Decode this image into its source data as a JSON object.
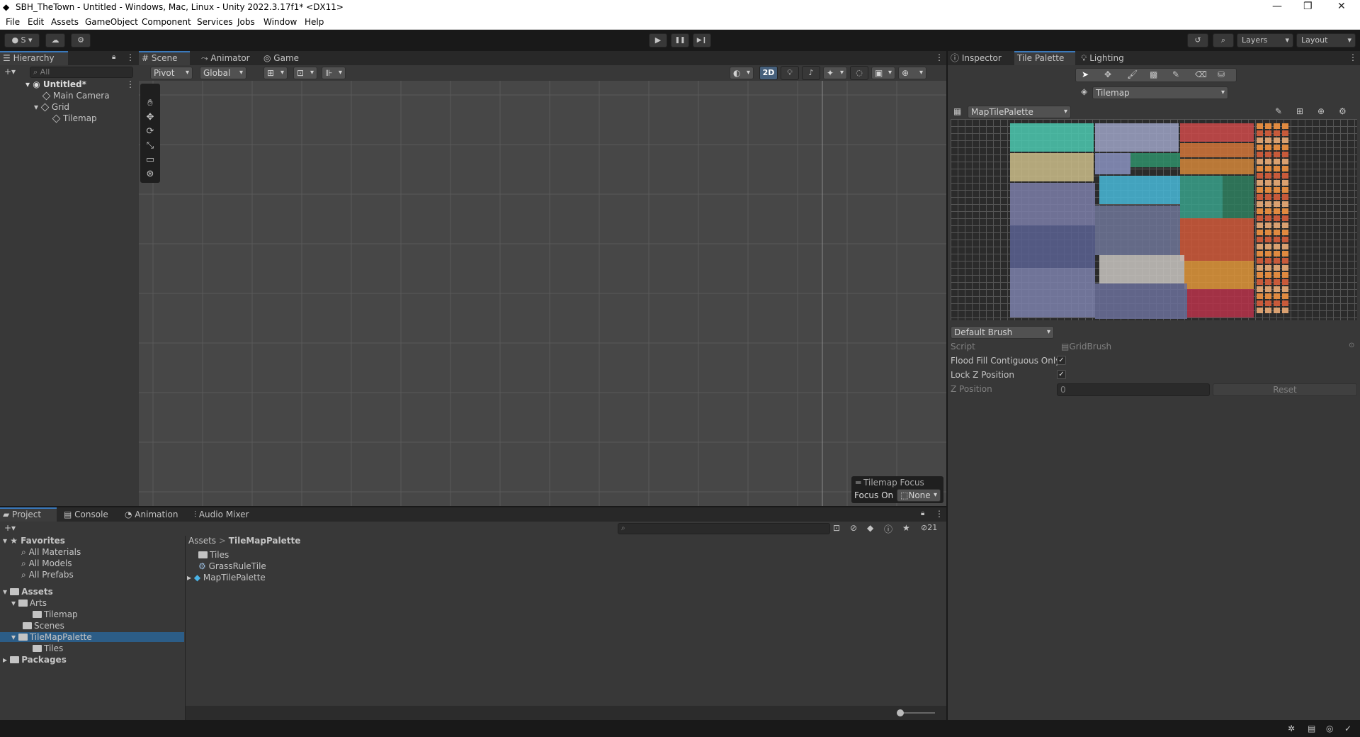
{
  "window": {
    "title": "SBH_TheTown - Untitled - Windows, Mac, Linux - Unity 2022.3.17f1* <DX11>",
    "minimize": "—",
    "restore": "❐",
    "close": "✕"
  },
  "menu": [
    "File",
    "Edit",
    "Assets",
    "GameObject",
    "Component",
    "Services",
    "Jobs",
    "Window",
    "Help"
  ],
  "toolbar": {
    "account": "S",
    "play": "▶",
    "pause": "❚❚",
    "step": "▶❙",
    "layers": "Layers",
    "layout": "Layout"
  },
  "hierarchy": {
    "tab": "Hierarchy",
    "search_placeholder": "All",
    "add": "+▾",
    "items": [
      "Untitled*",
      "Main Camera",
      "Grid",
      "Tilemap"
    ]
  },
  "scene_tabs": [
    "Scene",
    "Animator",
    "Game"
  ],
  "scene_toolbar": {
    "pivot": "Pivot",
    "global": "Global",
    "mode2d": "2D"
  },
  "tilemap_focus": {
    "title": "Tilemap Focus",
    "label": "Focus On",
    "value": "None"
  },
  "right_tabs": [
    "Inspector",
    "Tile Palette",
    "Lighting"
  ],
  "tile_palette": {
    "active_target": "Tilemap",
    "palette": "MapTilePalette",
    "brush": "Default Brush",
    "script_label": "Script",
    "script_value": "GridBrush",
    "flood_fill_label": "Flood Fill Contiguous Only",
    "flood_fill_checked": "✓",
    "lock_z_label": "Lock Z Position",
    "lock_z_checked": "✓",
    "z_position_label": "Z Position",
    "z_position_value": "0",
    "reset": "Reset"
  },
  "bottom_tabs": [
    "Project",
    "Console",
    "Animation",
    "Audio Mixer"
  ],
  "project": {
    "add": "+▾",
    "hidden_count": "21",
    "tree": {
      "favorites": "Favorites",
      "fav_items": [
        "All Materials",
        "All Models",
        "All Prefabs"
      ],
      "assets": "Assets",
      "arts": "Arts",
      "arts_tilemap": "Tilemap",
      "scenes": "Scenes",
      "tilemappalette": "TileMapPalette",
      "tiles": "Tiles",
      "packages": "Packages"
    },
    "breadcrumb": [
      "Assets",
      "TileMapPalette"
    ],
    "breadcrumb_sep": ">",
    "files": [
      "Tiles",
      "GrassRuleTile",
      "MapTilePalette"
    ]
  },
  "colors": {
    "accent": "#3a79bb",
    "selection": "#2c5d87",
    "panel": "#383838",
    "scene_bg": "#474747"
  }
}
